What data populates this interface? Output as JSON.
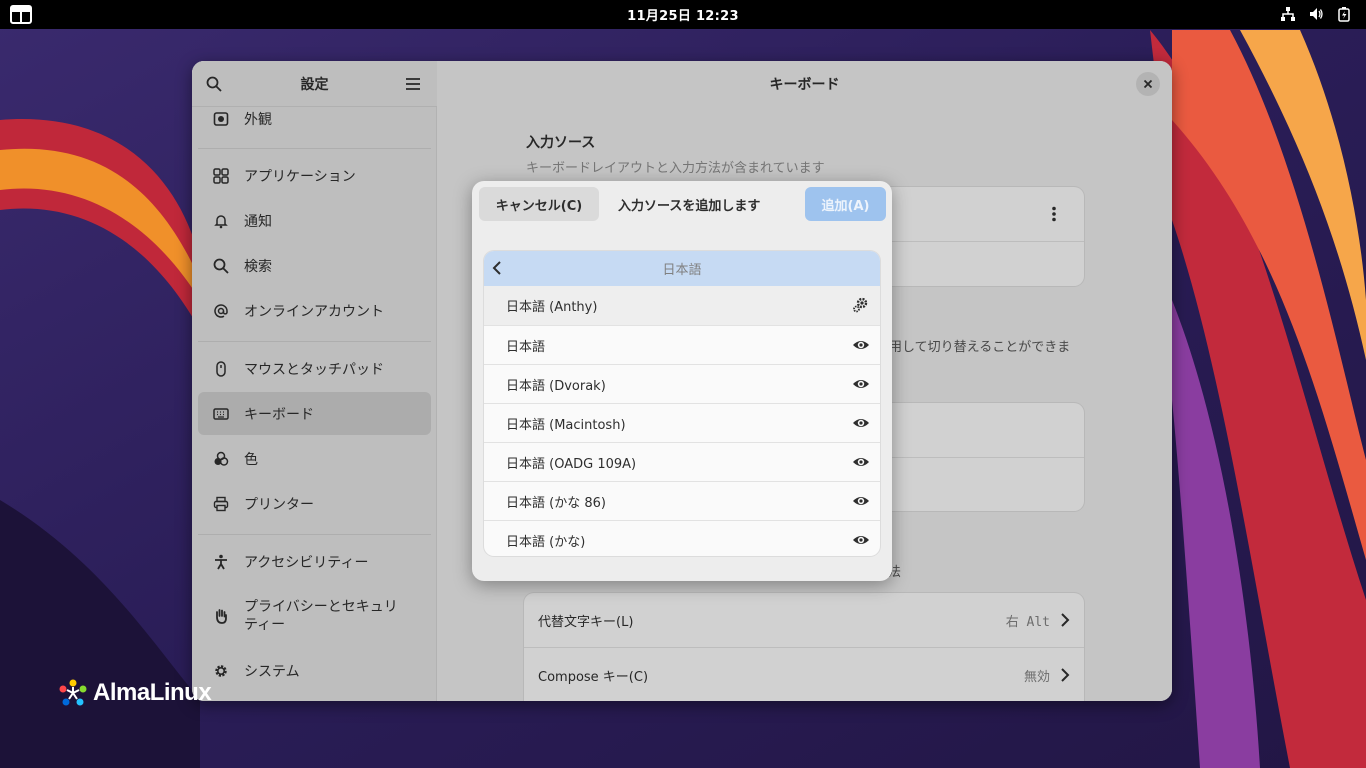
{
  "topbar": {
    "clock": "11月25日 12:23"
  },
  "desktop": {
    "logo_text": "AlmaLinux"
  },
  "sidebar": {
    "title": "設定",
    "items": [
      {
        "label": "外観",
        "icon": "appearance-icon"
      },
      {
        "label": "アプリケーション",
        "icon": "apps-grid-icon"
      },
      {
        "label": "通知",
        "icon": "bell-icon"
      },
      {
        "label": "検索",
        "icon": "search-icon"
      },
      {
        "label": "オンラインアカウント",
        "icon": "at-icon"
      },
      {
        "label": "マウスとタッチパッド",
        "icon": "mouse-icon"
      },
      {
        "label": "キーボード",
        "icon": "keyboard-icon",
        "active": true
      },
      {
        "label": "色",
        "icon": "color-icon"
      },
      {
        "label": "プリンター",
        "icon": "printer-icon"
      },
      {
        "label": "アクセシビリティー",
        "icon": "accessibility-icon"
      },
      {
        "label": "プライバシーとセキュリティー",
        "icon": "hand-icon"
      },
      {
        "label": "システム",
        "icon": "gear-icon"
      }
    ]
  },
  "content": {
    "title": "キーボード",
    "input_sources_heading": "入力ソース",
    "input_sources_sub": "キーボードレイアウトと入力方法が含まれています",
    "switch_text_partial": "用して切り替えることができま",
    "special_char_partial": "法",
    "rows": [
      {
        "label": "代替文字キー(L)",
        "value": "右 Alt"
      },
      {
        "label": "Compose キー(C)",
        "value": "無効"
      }
    ]
  },
  "dialog": {
    "cancel_label": "キャンセル(C)",
    "title": "入力ソースを追加します",
    "add_label": "追加(A)",
    "list_header": "日本語",
    "items": [
      {
        "label": "日本語 (Anthy)",
        "icon": "settings-gear-icon"
      },
      {
        "label": "日本語",
        "icon": "eye-icon"
      },
      {
        "label": "日本語 (Dvorak)",
        "icon": "eye-icon"
      },
      {
        "label": "日本語 (Macintosh)",
        "icon": "eye-icon"
      },
      {
        "label": "日本語 (OADG 109A)",
        "icon": "eye-icon"
      },
      {
        "label": "日本語 (かな 86)",
        "icon": "eye-icon"
      },
      {
        "label": "日本語 (かな)",
        "icon": "eye-icon"
      }
    ]
  }
}
